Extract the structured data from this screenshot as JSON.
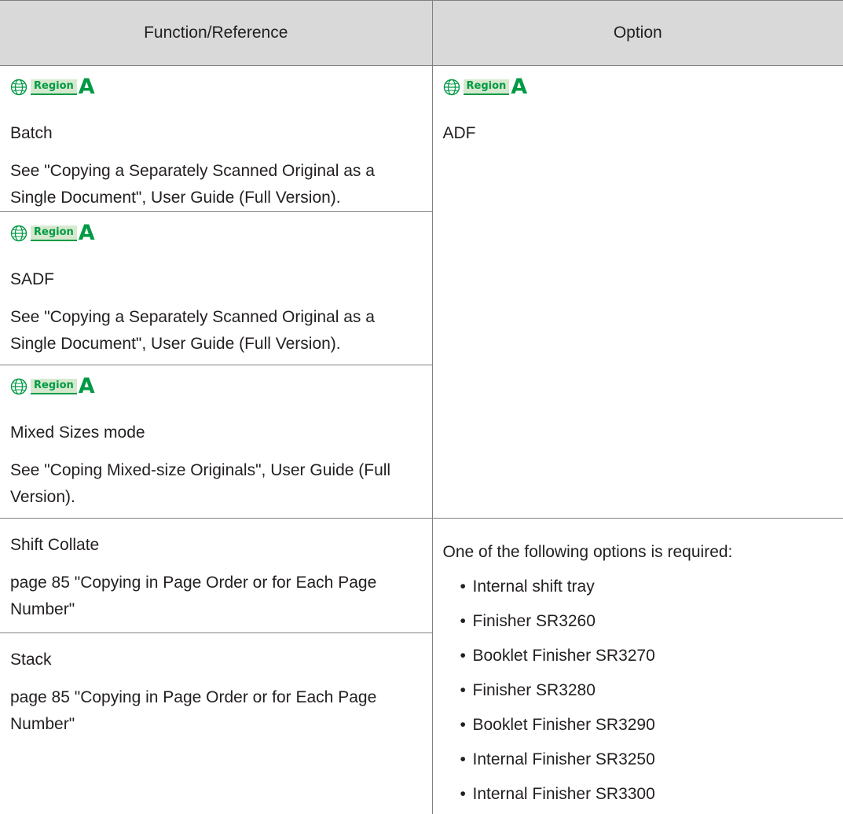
{
  "header": {
    "col1": "Function/Reference",
    "col2": "Option"
  },
  "region": {
    "badge": "Region",
    "letter": "A",
    "icon": "globe-icon"
  },
  "rows": [
    {
      "function": "Batch",
      "reference": "See \"Copying a Separately Scanned Original as a Single Document\", User Guide (Full Version)."
    },
    {
      "function": "SADF",
      "reference": "See \"Copying a Separately Scanned Original as a Single Document\", User Guide (Full Version)."
    },
    {
      "function": "Mixed Sizes mode",
      "reference": "See \"Coping Mixed-size Originals\", User Guide (Full Version)."
    },
    {
      "function": "Shift Collate",
      "reference": "page 85 \"Copying in Page Order or for Each Page Number\""
    },
    {
      "function": "Stack",
      "reference": "page 85 \"Copying in Page Order or for Each Page Number\""
    }
  ],
  "option_adf": "ADF",
  "option_required": {
    "intro": "One of the following options is required:",
    "items": [
      "Internal shift tray",
      "Finisher SR3260",
      "Booklet Finisher SR3270",
      "Finisher SR3280",
      "Booklet Finisher SR3290",
      "Internal Finisher SR3250",
      "Internal Finisher SR3300"
    ]
  },
  "colors": {
    "header_bg": "#d9d9d9",
    "region_green": "#009a44",
    "border": "#808080"
  }
}
